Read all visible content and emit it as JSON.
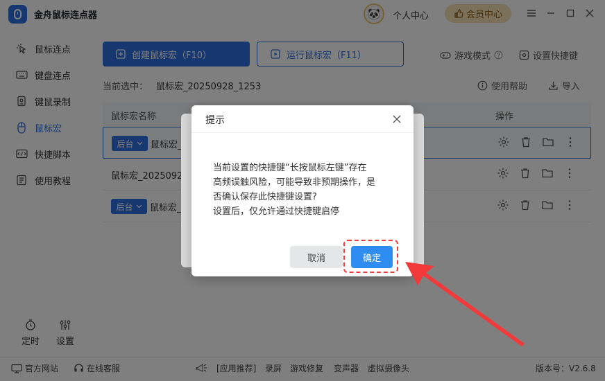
{
  "app": {
    "title": "金舟鼠标连点器",
    "user_center": "个人中心",
    "vip_center": "会员中心"
  },
  "sidebar": {
    "items": [
      {
        "label": "鼠标连点",
        "icon": "cursor-click-icon"
      },
      {
        "label": "键盘连点",
        "icon": "keyboard-icon"
      },
      {
        "label": "键鼠录制",
        "icon": "record-icon"
      },
      {
        "label": "鼠标宏",
        "icon": "mouse-icon"
      },
      {
        "label": "快捷脚本",
        "icon": "script-icon"
      },
      {
        "label": "使用教程",
        "icon": "tutorial-icon"
      }
    ],
    "active_index": 3,
    "bottom": [
      {
        "label": "定时",
        "icon": "timer-icon"
      },
      {
        "label": "设置",
        "icon": "settings-sliders-icon"
      }
    ]
  },
  "toolbar": {
    "create_label": "创建鼠标宏（F10）",
    "run_label": "运行鼠标宏（F11）",
    "game_mode": "游戏模式",
    "hotkey_settings": "设置快捷键"
  },
  "selection": {
    "label": "当前选中：",
    "value": "鼠标宏_20250928_1253"
  },
  "help": {
    "help_label": "使用帮助",
    "import_label": "导入"
  },
  "table": {
    "col_name": "鼠标宏名称",
    "col_actions": "操作",
    "rows": [
      {
        "mode": "后台",
        "name": "鼠标宏_"
      },
      {
        "mode": "",
        "name": "鼠标宏_2025092"
      },
      {
        "mode": "后台",
        "name": "鼠标宏_"
      }
    ]
  },
  "footer": {
    "website": "官方网站",
    "support": "在线客服",
    "recommend": "[应用推荐]",
    "apps": [
      "录屏",
      "游戏修复",
      "变声器",
      "虚拟摄像头"
    ],
    "version": "版本号：V2.6.8"
  },
  "dialog": {
    "title": "提示",
    "message_lines": [
      "当前设置的快捷键“长按鼠标左键”存在",
      "高频误触风险，可能导致非预期操作，是",
      "否确认保存此快捷键设置?",
      "设置后，仅允许通过快捷键启停"
    ],
    "cancel": "取消",
    "confirm": "确定"
  },
  "colors": {
    "primary": "#2f6fe0",
    "confirm": "#2f8cf0",
    "highlight": "#f23a3a"
  }
}
